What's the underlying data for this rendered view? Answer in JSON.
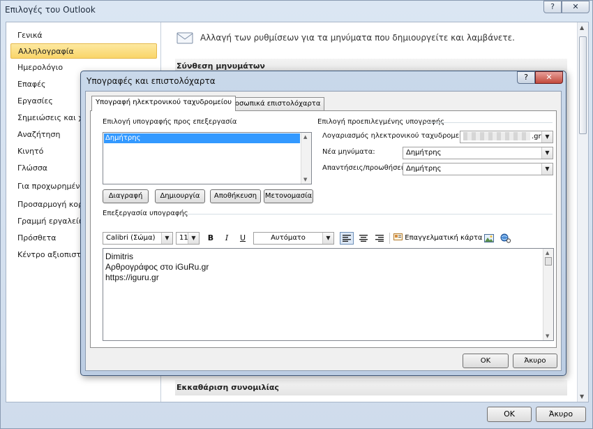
{
  "window": {
    "title": "Επιλογές του Outlook",
    "help_icon": "?",
    "close_icon": "✕",
    "ok_label": "OK",
    "cancel_label": "Άκυρο"
  },
  "nav": {
    "items": [
      {
        "label": "Γενικά"
      },
      {
        "label": "Αλληλογραφία"
      },
      {
        "label": "Ημερολόγιο"
      },
      {
        "label": "Επαφές"
      },
      {
        "label": "Εργασίες"
      },
      {
        "label": "Σημειώσεις και χρονικό"
      },
      {
        "label": "Αναζήτηση"
      },
      {
        "label": "Κινητό"
      },
      {
        "label": "Γλώσσα"
      },
      {
        "label": "Για προχωρημένους"
      },
      {
        "label": "Προσαρμογή κορδέλας"
      },
      {
        "label": "Γραμμή εργαλείων γρήγορης"
      },
      {
        "label": "Πρόσθετα"
      },
      {
        "label": "Κέντρο αξιοπιστίας"
      }
    ],
    "active_index": 1
  },
  "content": {
    "header": "Αλλαγή των ρυθμίσεων για τα μηνύματα που δημιουργείτε και λαμβάνετε.",
    "section_compose": "Σύνθεση μηνυμάτων",
    "section_cleanup": "Εκκαθάριση συνομιλίας"
  },
  "dialog": {
    "title": "Υπογραφές και επιστολόχαρτα",
    "help_icon": "?",
    "close_icon": "✕",
    "tabs": [
      {
        "label": "Υπογραφή ηλεκτρονικού ταχυδρομείου"
      },
      {
        "label": "Προσωπικά επιστολόχαρτα"
      }
    ],
    "select_label": "Επιλογή υπογραφής προς επεξεργασία",
    "signatures": [
      {
        "name": "Δημήτρης",
        "selected": true
      }
    ],
    "buttons": {
      "delete": "Διαγραφή",
      "create": "Δημιουργία",
      "save": "Αποθήκευση",
      "rename": "Μετονομασία"
    },
    "default_section": "Επιλογή προεπιλεγμένης υπογραφής",
    "account_label": "Λογαριασμός ηλεκτρονικού ταχυδρομείου:",
    "account_value": ".gr",
    "new_messages_label": "Νέα μηνύματα:",
    "new_messages_value": "Δημήτρης",
    "replies_label": "Απαντήσεις/προωθήσεις:",
    "replies_value": "Δημήτρης",
    "edit_label": "Επεξεργασία υπογραφής",
    "toolbar": {
      "font": "Calibri (Σώμα)",
      "size": "11",
      "bold": "B",
      "italic": "I",
      "underline": "U",
      "color": "Αυτόματο",
      "business_card": "Επαγγελματική κάρτα"
    },
    "signature_lines": [
      "Dimitris",
      "Αρθρογράφος στο iGuRu.gr",
      "https://iguru.gr"
    ],
    "ok_label": "OK",
    "cancel_label": "Άκυρο"
  }
}
